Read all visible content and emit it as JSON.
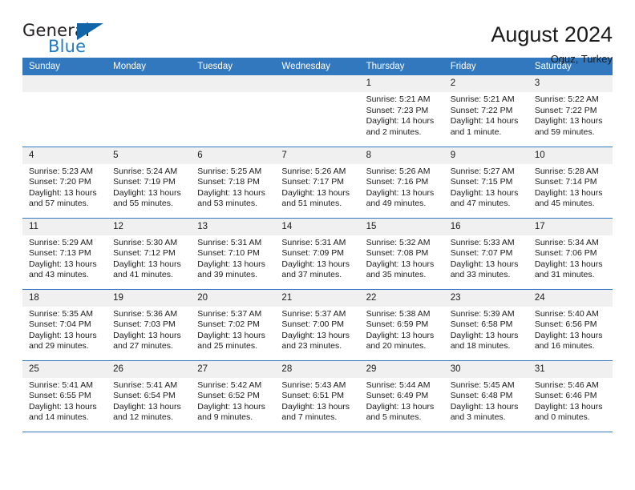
{
  "brand": {
    "word_one": "General",
    "word_two": "Blue",
    "triangle_color": "#1064a8",
    "blue_text_color": "#1f7cc4"
  },
  "header": {
    "title": "August 2024",
    "subtitle": "Oguz, Turkey"
  },
  "theme": {
    "header_bg": "#3178be",
    "header_text": "#ffffff",
    "daynum_bg": "#f0f0f0",
    "grid_line": "#3178be"
  },
  "labels": {
    "sunrise": "Sunrise:",
    "sunset": "Sunset:",
    "daylight": "Daylight:"
  },
  "weekdays": [
    "Sunday",
    "Monday",
    "Tuesday",
    "Wednesday",
    "Thursday",
    "Friday",
    "Saturday"
  ],
  "weeks": [
    [
      {
        "day": "",
        "empty": true
      },
      {
        "day": "",
        "empty": true
      },
      {
        "day": "",
        "empty": true
      },
      {
        "day": "",
        "empty": true
      },
      {
        "day": "1",
        "sunrise": "Sunrise: 5:21 AM",
        "sunset": "Sunset: 7:23 PM",
        "daylight": "Daylight: 14 hours and 2 minutes."
      },
      {
        "day": "2",
        "sunrise": "Sunrise: 5:21 AM",
        "sunset": "Sunset: 7:22 PM",
        "daylight": "Daylight: 14 hours and 1 minute."
      },
      {
        "day": "3",
        "sunrise": "Sunrise: 5:22 AM",
        "sunset": "Sunset: 7:22 PM",
        "daylight": "Daylight: 13 hours and 59 minutes."
      }
    ],
    [
      {
        "day": "4",
        "sunrise": "Sunrise: 5:23 AM",
        "sunset": "Sunset: 7:20 PM",
        "daylight": "Daylight: 13 hours and 57 minutes."
      },
      {
        "day": "5",
        "sunrise": "Sunrise: 5:24 AM",
        "sunset": "Sunset: 7:19 PM",
        "daylight": "Daylight: 13 hours and 55 minutes."
      },
      {
        "day": "6",
        "sunrise": "Sunrise: 5:25 AM",
        "sunset": "Sunset: 7:18 PM",
        "daylight": "Daylight: 13 hours and 53 minutes."
      },
      {
        "day": "7",
        "sunrise": "Sunrise: 5:26 AM",
        "sunset": "Sunset: 7:17 PM",
        "daylight": "Daylight: 13 hours and 51 minutes."
      },
      {
        "day": "8",
        "sunrise": "Sunrise: 5:26 AM",
        "sunset": "Sunset: 7:16 PM",
        "daylight": "Daylight: 13 hours and 49 minutes."
      },
      {
        "day": "9",
        "sunrise": "Sunrise: 5:27 AM",
        "sunset": "Sunset: 7:15 PM",
        "daylight": "Daylight: 13 hours and 47 minutes."
      },
      {
        "day": "10",
        "sunrise": "Sunrise: 5:28 AM",
        "sunset": "Sunset: 7:14 PM",
        "daylight": "Daylight: 13 hours and 45 minutes."
      }
    ],
    [
      {
        "day": "11",
        "sunrise": "Sunrise: 5:29 AM",
        "sunset": "Sunset: 7:13 PM",
        "daylight": "Daylight: 13 hours and 43 minutes."
      },
      {
        "day": "12",
        "sunrise": "Sunrise: 5:30 AM",
        "sunset": "Sunset: 7:12 PM",
        "daylight": "Daylight: 13 hours and 41 minutes."
      },
      {
        "day": "13",
        "sunrise": "Sunrise: 5:31 AM",
        "sunset": "Sunset: 7:10 PM",
        "daylight": "Daylight: 13 hours and 39 minutes."
      },
      {
        "day": "14",
        "sunrise": "Sunrise: 5:31 AM",
        "sunset": "Sunset: 7:09 PM",
        "daylight": "Daylight: 13 hours and 37 minutes."
      },
      {
        "day": "15",
        "sunrise": "Sunrise: 5:32 AM",
        "sunset": "Sunset: 7:08 PM",
        "daylight": "Daylight: 13 hours and 35 minutes."
      },
      {
        "day": "16",
        "sunrise": "Sunrise: 5:33 AM",
        "sunset": "Sunset: 7:07 PM",
        "daylight": "Daylight: 13 hours and 33 minutes."
      },
      {
        "day": "17",
        "sunrise": "Sunrise: 5:34 AM",
        "sunset": "Sunset: 7:06 PM",
        "daylight": "Daylight: 13 hours and 31 minutes."
      }
    ],
    [
      {
        "day": "18",
        "sunrise": "Sunrise: 5:35 AM",
        "sunset": "Sunset: 7:04 PM",
        "daylight": "Daylight: 13 hours and 29 minutes."
      },
      {
        "day": "19",
        "sunrise": "Sunrise: 5:36 AM",
        "sunset": "Sunset: 7:03 PM",
        "daylight": "Daylight: 13 hours and 27 minutes."
      },
      {
        "day": "20",
        "sunrise": "Sunrise: 5:37 AM",
        "sunset": "Sunset: 7:02 PM",
        "daylight": "Daylight: 13 hours and 25 minutes."
      },
      {
        "day": "21",
        "sunrise": "Sunrise: 5:37 AM",
        "sunset": "Sunset: 7:00 PM",
        "daylight": "Daylight: 13 hours and 23 minutes."
      },
      {
        "day": "22",
        "sunrise": "Sunrise: 5:38 AM",
        "sunset": "Sunset: 6:59 PM",
        "daylight": "Daylight: 13 hours and 20 minutes."
      },
      {
        "day": "23",
        "sunrise": "Sunrise: 5:39 AM",
        "sunset": "Sunset: 6:58 PM",
        "daylight": "Daylight: 13 hours and 18 minutes."
      },
      {
        "day": "24",
        "sunrise": "Sunrise: 5:40 AM",
        "sunset": "Sunset: 6:56 PM",
        "daylight": "Daylight: 13 hours and 16 minutes."
      }
    ],
    [
      {
        "day": "25",
        "sunrise": "Sunrise: 5:41 AM",
        "sunset": "Sunset: 6:55 PM",
        "daylight": "Daylight: 13 hours and 14 minutes."
      },
      {
        "day": "26",
        "sunrise": "Sunrise: 5:41 AM",
        "sunset": "Sunset: 6:54 PM",
        "daylight": "Daylight: 13 hours and 12 minutes."
      },
      {
        "day": "27",
        "sunrise": "Sunrise: 5:42 AM",
        "sunset": "Sunset: 6:52 PM",
        "daylight": "Daylight: 13 hours and 9 minutes."
      },
      {
        "day": "28",
        "sunrise": "Sunrise: 5:43 AM",
        "sunset": "Sunset: 6:51 PM",
        "daylight": "Daylight: 13 hours and 7 minutes."
      },
      {
        "day": "29",
        "sunrise": "Sunrise: 5:44 AM",
        "sunset": "Sunset: 6:49 PM",
        "daylight": "Daylight: 13 hours and 5 minutes."
      },
      {
        "day": "30",
        "sunrise": "Sunrise: 5:45 AM",
        "sunset": "Sunset: 6:48 PM",
        "daylight": "Daylight: 13 hours and 3 minutes."
      },
      {
        "day": "31",
        "sunrise": "Sunrise: 5:46 AM",
        "sunset": "Sunset: 6:46 PM",
        "daylight": "Daylight: 13 hours and 0 minutes."
      }
    ]
  ]
}
